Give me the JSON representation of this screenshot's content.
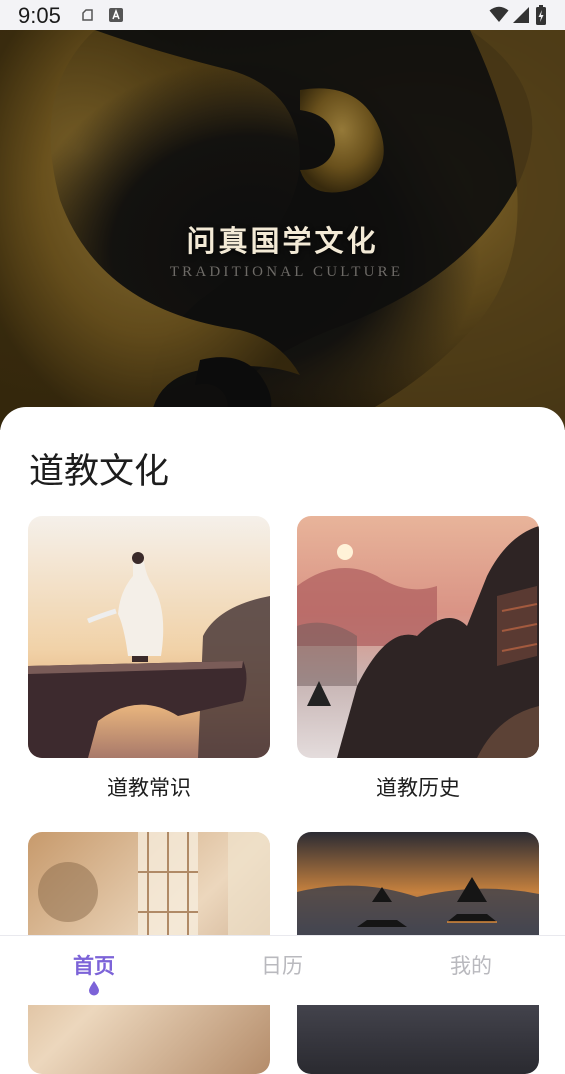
{
  "status_bar": {
    "time": "9:05",
    "icons": [
      "sim-icon",
      "keyboard-a-icon",
      "wifi-icon",
      "signal-icon",
      "battery-charging-icon"
    ]
  },
  "hero": {
    "title": "问真国学文化",
    "subtitle": "TRADITIONAL CULTURE"
  },
  "section": {
    "title": "道教文化",
    "cards": [
      {
        "label": "道教常识",
        "image": "robed-figure-on-cliff"
      },
      {
        "label": "道教历史",
        "image": "misty-mountain-temple"
      },
      {
        "label": "",
        "image": "sunlit-interior-window"
      },
      {
        "label": "",
        "image": "pagoda-sunset"
      }
    ]
  },
  "nav": {
    "items": [
      {
        "label": "首页",
        "active": true
      },
      {
        "label": "日历",
        "active": false
      },
      {
        "label": "我的",
        "active": false
      }
    ],
    "accent": "#7c63d8",
    "inactive_color": "#b9b9be"
  }
}
